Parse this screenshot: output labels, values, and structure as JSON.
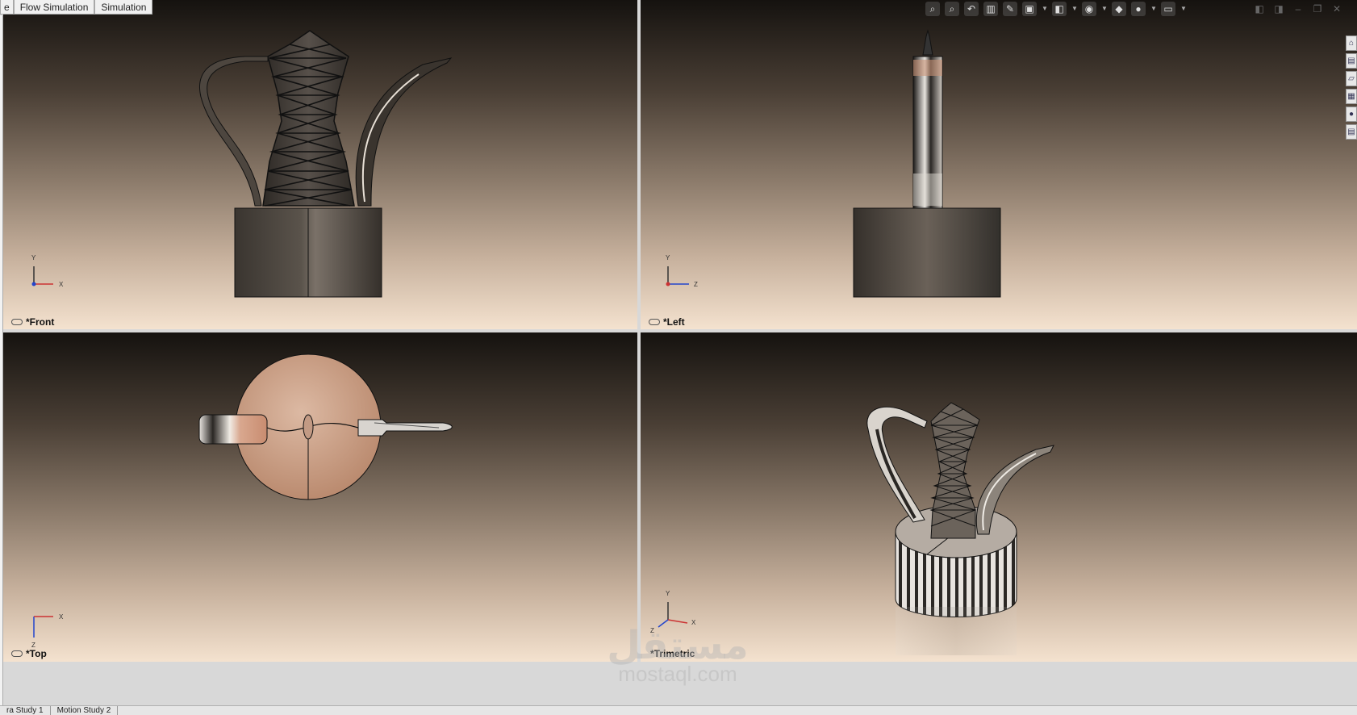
{
  "tabs": [
    {
      "label": "e"
    },
    {
      "label": "Flow Simulation"
    },
    {
      "label": "Simulation"
    }
  ],
  "viewports": {
    "front": {
      "label": "*Front",
      "axes": {
        "vertical": "Y",
        "horizontal": "X"
      }
    },
    "left": {
      "label": "*Left",
      "axes": {
        "vertical": "Y",
        "horizontal": "Z"
      }
    },
    "top": {
      "label": "*Top",
      "axes": {
        "vertical": "Z",
        "horizontal": "X"
      }
    },
    "trimetric": {
      "label": "*Trimetric",
      "axes": {
        "vertical": "Y",
        "horizontal": "X",
        "depth": "Z"
      }
    }
  },
  "hud_toolbar": [
    {
      "icon": "zoom-to-fit-icon"
    },
    {
      "icon": "zoom-to-area-icon"
    },
    {
      "icon": "previous-view-icon"
    },
    {
      "icon": "section-view-icon"
    },
    {
      "icon": "dynamic-annotation-icon"
    },
    {
      "icon": "view-orientation-icon"
    },
    {
      "icon": "display-style-icon"
    },
    {
      "icon": "hide-show-items-icon"
    },
    {
      "icon": "edit-appearance-icon"
    },
    {
      "icon": "apply-scene-icon"
    },
    {
      "icon": "view-settings-icon"
    }
  ],
  "window_controls": [
    {
      "icon": "viewport-prev-icon"
    },
    {
      "icon": "viewport-next-icon"
    },
    {
      "icon": "minimize-icon"
    },
    {
      "icon": "restore-icon"
    },
    {
      "icon": "close-icon"
    }
  ],
  "task_pane": [
    {
      "icon": "home-icon"
    },
    {
      "icon": "design-library-icon"
    },
    {
      "icon": "file-explorer-icon"
    },
    {
      "icon": "view-palette-icon"
    },
    {
      "icon": "appearances-icon"
    },
    {
      "icon": "custom-properties-icon"
    }
  ],
  "bottom_tabs": [
    {
      "label": "ra Study 1"
    },
    {
      "label": "Motion Study 2"
    }
  ],
  "watermark": {
    "arabic": "مستقل",
    "latin": "mostaql.com"
  },
  "colors": {
    "viewport_top": "#15120f",
    "viewport_bottom": "#f4e2cf",
    "top_disc": "#c99c82"
  }
}
